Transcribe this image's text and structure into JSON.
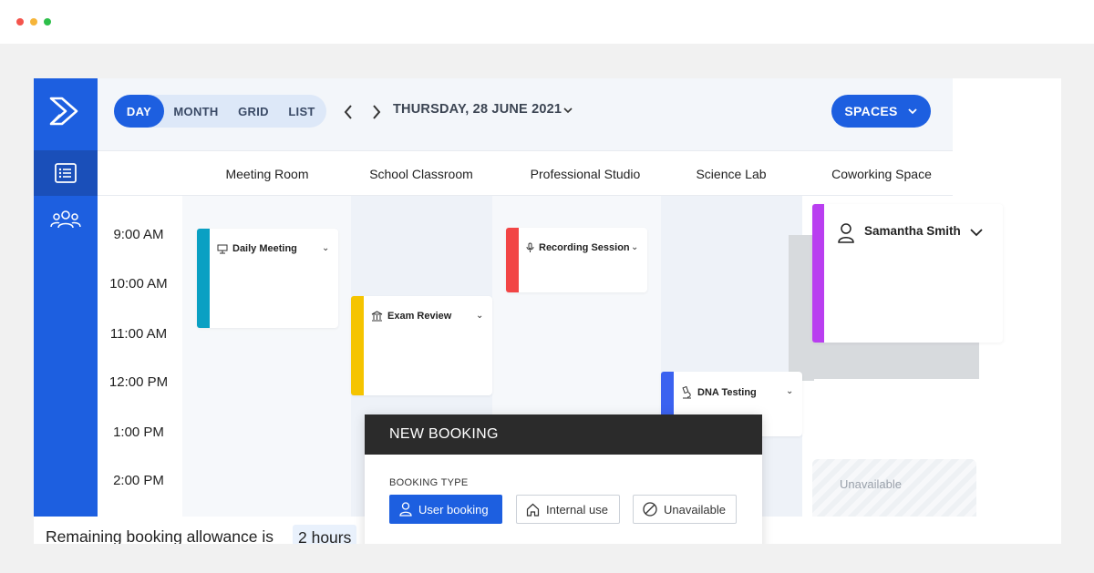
{
  "views": {
    "day": "DAY",
    "month": "MONTH",
    "grid": "GRID",
    "list": "LIST"
  },
  "date_title": "THURSDAY, 28 JUNE 2021",
  "spaces_button": "SPACES",
  "columns": [
    "Meeting Room",
    "School Classroom",
    "Professional Studio",
    "Science Lab",
    "Coworking Space"
  ],
  "times": [
    "9:00 AM",
    "10:00 AM",
    "11:00 AM",
    "12:00 PM",
    "1:00 PM",
    "2:00 PM"
  ],
  "events": {
    "daily_meeting": {
      "title": "Daily Meeting",
      "color": "#0aa0c3",
      "icon": "presentation-icon"
    },
    "exam_review": {
      "title": "Exam Review",
      "color": "#f5c400",
      "icon": "institution-icon"
    },
    "recording_session": {
      "title": "Recording Session",
      "color": "#f24545",
      "icon": "microphone-icon"
    },
    "dna_testing": {
      "title": "DNA Testing",
      "color": "#3b62f0",
      "icon": "microscope-icon"
    }
  },
  "user_card": {
    "name": "Samantha Smith",
    "color": "#b93ef0"
  },
  "unavailable_label": "Unavailable",
  "modal": {
    "title": "NEW BOOKING",
    "label": "BOOKING TYPE",
    "options": {
      "user": "User booking",
      "internal": "Internal use",
      "unavailable": "Unavailable"
    }
  },
  "allowance": {
    "text": "Remaining booking allowance is",
    "value": "2 hours"
  }
}
